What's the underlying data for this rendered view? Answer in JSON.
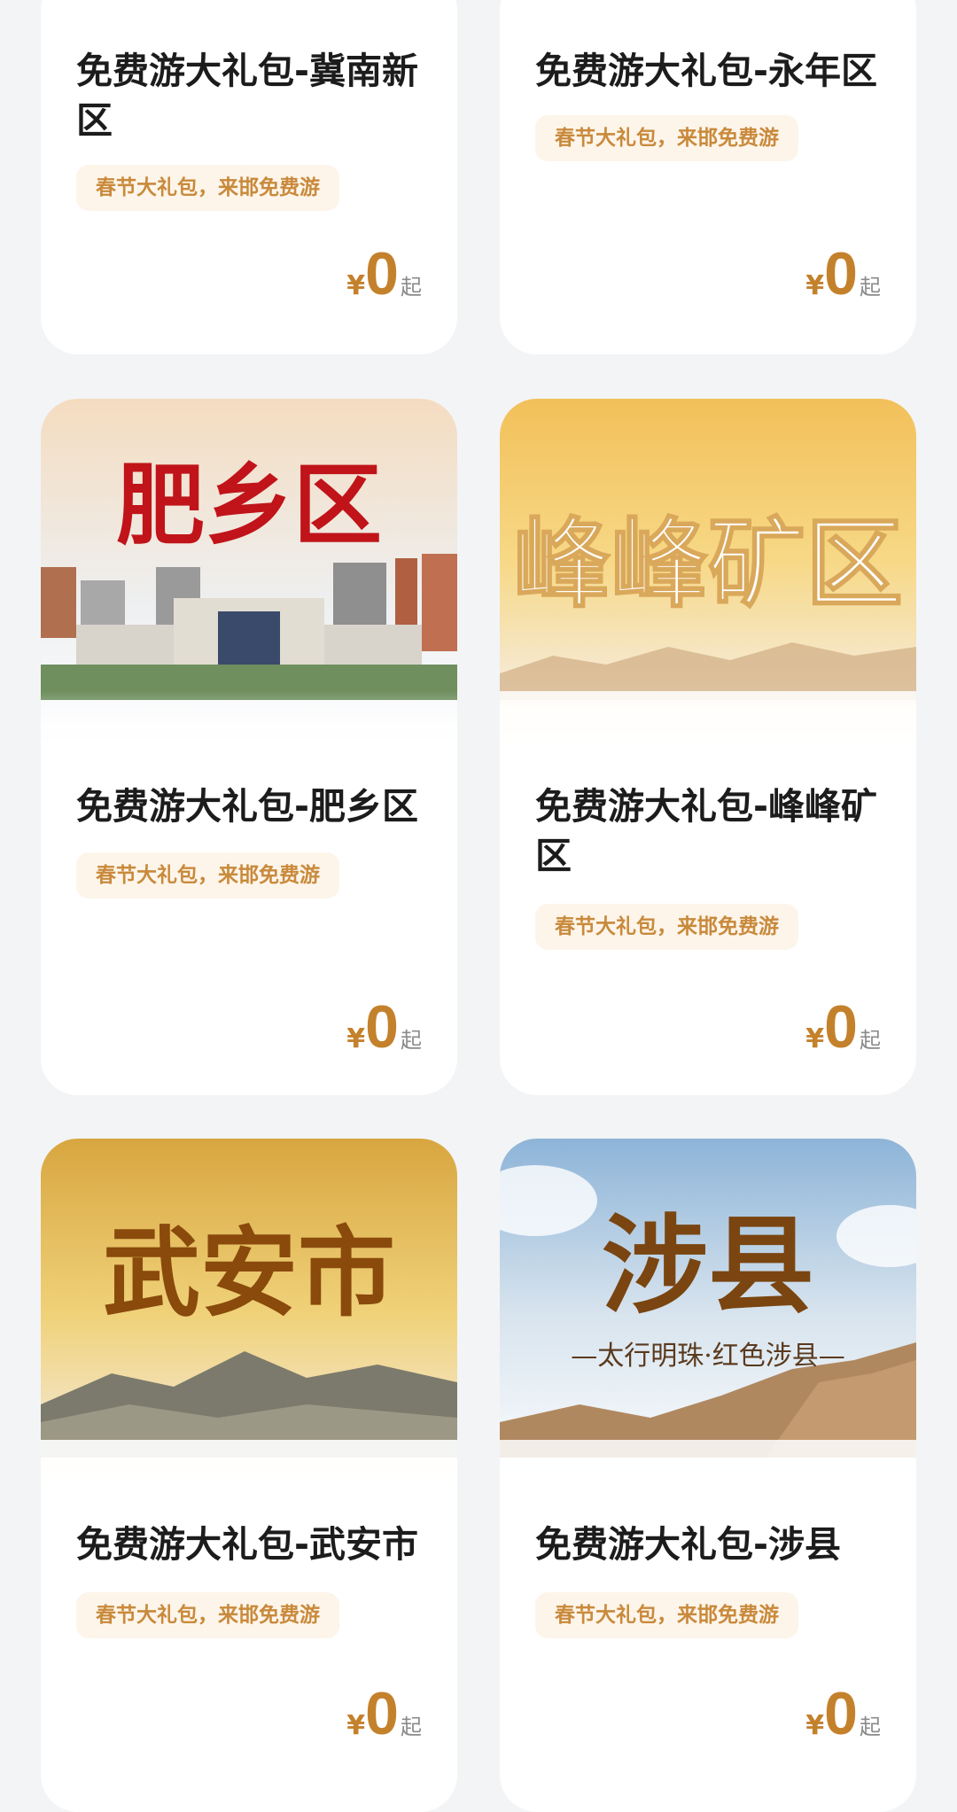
{
  "cards": [
    {
      "title": "免费游大礼包-冀南新区",
      "tag": "春节大礼包，来邯免费游",
      "currency": "¥",
      "price": "0",
      "suffix": "起"
    },
    {
      "title": "免费游大礼包-永年区",
      "tag": "春节大礼包，来邯免费游",
      "currency": "¥",
      "price": "0",
      "suffix": "起"
    },
    {
      "title": "免费游大礼包-肥乡区",
      "tag": "春节大礼包，来邯免费游",
      "currency": "¥",
      "price": "0",
      "suffix": "起",
      "image_text": "肥乡区"
    },
    {
      "title": "免费游大礼包-峰峰矿区",
      "tag": "春节大礼包，来邯免费游",
      "currency": "¥",
      "price": "0",
      "suffix": "起",
      "image_text": "峰峰矿区"
    },
    {
      "title": "免费游大礼包-武安市",
      "tag": "春节大礼包，来邯免费游",
      "currency": "¥",
      "price": "0",
      "suffix": "起",
      "image_text": "武安市"
    },
    {
      "title": "免费游大礼包-涉县",
      "tag": "春节大礼包，来邯免费游",
      "currency": "¥",
      "price": "0",
      "suffix": "起",
      "image_text": "涉县",
      "image_subtext": "—太行明珠·红色涉县—"
    }
  ],
  "colors": {
    "accent": "#c4812c",
    "tag_bg": "#fdf5ea",
    "tag_text": "#c98a3c",
    "page_bg": "#f3f4f6"
  }
}
